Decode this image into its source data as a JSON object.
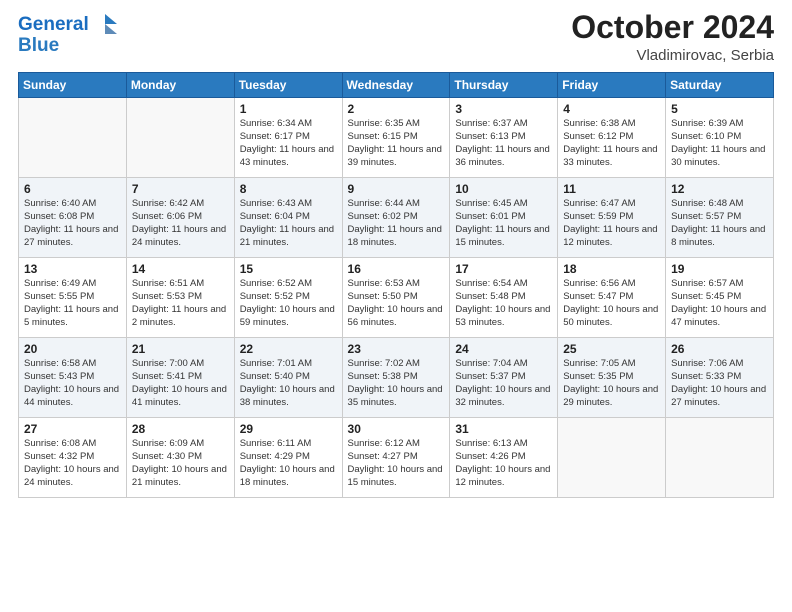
{
  "header": {
    "logo_line1": "General",
    "logo_line2": "Blue",
    "month": "October 2024",
    "location": "Vladimirovac, Serbia"
  },
  "weekdays": [
    "Sunday",
    "Monday",
    "Tuesday",
    "Wednesday",
    "Thursday",
    "Friday",
    "Saturday"
  ],
  "weeks": [
    [
      {
        "day": "",
        "info": ""
      },
      {
        "day": "",
        "info": ""
      },
      {
        "day": "1",
        "info": "Sunrise: 6:34 AM\nSunset: 6:17 PM\nDaylight: 11 hours and 43 minutes."
      },
      {
        "day": "2",
        "info": "Sunrise: 6:35 AM\nSunset: 6:15 PM\nDaylight: 11 hours and 39 minutes."
      },
      {
        "day": "3",
        "info": "Sunrise: 6:37 AM\nSunset: 6:13 PM\nDaylight: 11 hours and 36 minutes."
      },
      {
        "day": "4",
        "info": "Sunrise: 6:38 AM\nSunset: 6:12 PM\nDaylight: 11 hours and 33 minutes."
      },
      {
        "day": "5",
        "info": "Sunrise: 6:39 AM\nSunset: 6:10 PM\nDaylight: 11 hours and 30 minutes."
      }
    ],
    [
      {
        "day": "6",
        "info": "Sunrise: 6:40 AM\nSunset: 6:08 PM\nDaylight: 11 hours and 27 minutes."
      },
      {
        "day": "7",
        "info": "Sunrise: 6:42 AM\nSunset: 6:06 PM\nDaylight: 11 hours and 24 minutes."
      },
      {
        "day": "8",
        "info": "Sunrise: 6:43 AM\nSunset: 6:04 PM\nDaylight: 11 hours and 21 minutes."
      },
      {
        "day": "9",
        "info": "Sunrise: 6:44 AM\nSunset: 6:02 PM\nDaylight: 11 hours and 18 minutes."
      },
      {
        "day": "10",
        "info": "Sunrise: 6:45 AM\nSunset: 6:01 PM\nDaylight: 11 hours and 15 minutes."
      },
      {
        "day": "11",
        "info": "Sunrise: 6:47 AM\nSunset: 5:59 PM\nDaylight: 11 hours and 12 minutes."
      },
      {
        "day": "12",
        "info": "Sunrise: 6:48 AM\nSunset: 5:57 PM\nDaylight: 11 hours and 8 minutes."
      }
    ],
    [
      {
        "day": "13",
        "info": "Sunrise: 6:49 AM\nSunset: 5:55 PM\nDaylight: 11 hours and 5 minutes."
      },
      {
        "day": "14",
        "info": "Sunrise: 6:51 AM\nSunset: 5:53 PM\nDaylight: 11 hours and 2 minutes."
      },
      {
        "day": "15",
        "info": "Sunrise: 6:52 AM\nSunset: 5:52 PM\nDaylight: 10 hours and 59 minutes."
      },
      {
        "day": "16",
        "info": "Sunrise: 6:53 AM\nSunset: 5:50 PM\nDaylight: 10 hours and 56 minutes."
      },
      {
        "day": "17",
        "info": "Sunrise: 6:54 AM\nSunset: 5:48 PM\nDaylight: 10 hours and 53 minutes."
      },
      {
        "day": "18",
        "info": "Sunrise: 6:56 AM\nSunset: 5:47 PM\nDaylight: 10 hours and 50 minutes."
      },
      {
        "day": "19",
        "info": "Sunrise: 6:57 AM\nSunset: 5:45 PM\nDaylight: 10 hours and 47 minutes."
      }
    ],
    [
      {
        "day": "20",
        "info": "Sunrise: 6:58 AM\nSunset: 5:43 PM\nDaylight: 10 hours and 44 minutes."
      },
      {
        "day": "21",
        "info": "Sunrise: 7:00 AM\nSunset: 5:41 PM\nDaylight: 10 hours and 41 minutes."
      },
      {
        "day": "22",
        "info": "Sunrise: 7:01 AM\nSunset: 5:40 PM\nDaylight: 10 hours and 38 minutes."
      },
      {
        "day": "23",
        "info": "Sunrise: 7:02 AM\nSunset: 5:38 PM\nDaylight: 10 hours and 35 minutes."
      },
      {
        "day": "24",
        "info": "Sunrise: 7:04 AM\nSunset: 5:37 PM\nDaylight: 10 hours and 32 minutes."
      },
      {
        "day": "25",
        "info": "Sunrise: 7:05 AM\nSunset: 5:35 PM\nDaylight: 10 hours and 29 minutes."
      },
      {
        "day": "26",
        "info": "Sunrise: 7:06 AM\nSunset: 5:33 PM\nDaylight: 10 hours and 27 minutes."
      }
    ],
    [
      {
        "day": "27",
        "info": "Sunrise: 6:08 AM\nSunset: 4:32 PM\nDaylight: 10 hours and 24 minutes."
      },
      {
        "day": "28",
        "info": "Sunrise: 6:09 AM\nSunset: 4:30 PM\nDaylight: 10 hours and 21 minutes."
      },
      {
        "day": "29",
        "info": "Sunrise: 6:11 AM\nSunset: 4:29 PM\nDaylight: 10 hours and 18 minutes."
      },
      {
        "day": "30",
        "info": "Sunrise: 6:12 AM\nSunset: 4:27 PM\nDaylight: 10 hours and 15 minutes."
      },
      {
        "day": "31",
        "info": "Sunrise: 6:13 AM\nSunset: 4:26 PM\nDaylight: 10 hours and 12 minutes."
      },
      {
        "day": "",
        "info": ""
      },
      {
        "day": "",
        "info": ""
      }
    ]
  ]
}
